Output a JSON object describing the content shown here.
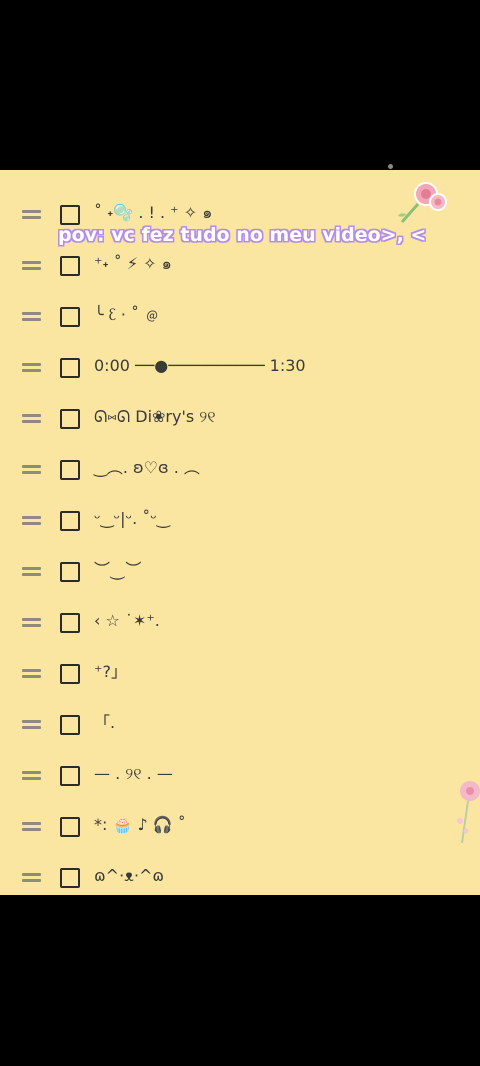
{
  "caption": "pov: vc fez tudo no meu video>, <",
  "checklist": [
    {
      "text": "˚ ˖🫧 . ! . ⁺ ✧ ๑"
    },
    {
      "text": "⁺˖ ˚ ⚡︎ ✧ ๑"
    },
    {
      "text": "╰ ᦷ ⋅ ˚ ﹫"
    },
    {
      "text": "0:00 ──●────────── 1:30"
    },
    {
      "text": "ᘏ⑅ᘏ Di❀ry's ୨୧"
    },
    {
      "text": "‿︵. ʚ♡ɞ . ︵"
    },
    {
      "text": "ᵕ‿ᵕ|ᵕ. ˚ᵕ‿"
    },
    {
      "text": "︶⏝︶"
    },
    {
      "text": "‹ ☆ ˙✶⁺."
    },
    {
      "text": "⁺?」"
    },
    {
      "text": "「."
    },
    {
      "text": "— . ୨୧ . —"
    },
    {
      "text": "*: 🧁 ♪ 🎧 ˚"
    },
    {
      "text": "ɷ^⋅ᴥ⋅^ɷ"
    }
  ],
  "colors": {
    "note_background": "#fbe6a1",
    "screen_background": "#000000",
    "caption_outline": "#b48ee6"
  },
  "icons": [
    "drag-handle-icon",
    "checkbox-icon",
    "rose-sticker-icon"
  ]
}
